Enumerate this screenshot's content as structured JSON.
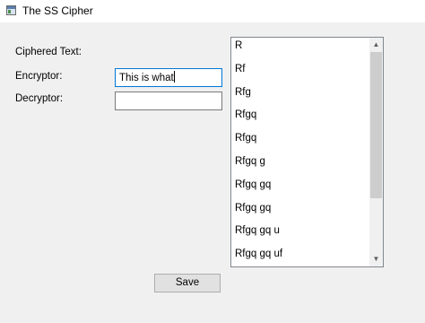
{
  "window": {
    "title": "The SS Cipher"
  },
  "form": {
    "ciphered_label": "Ciphered Text:",
    "encryptor_label": "Encryptor:",
    "decryptor_label": "Decryptor:",
    "encryptor_value": "This is what",
    "decryptor_value": ""
  },
  "listbox": {
    "items": [
      "R",
      "Rf",
      "Rfg",
      "Rfgq",
      "Rfgq",
      "Rfgq g",
      "Rfgq gq",
      "Rfgq gq",
      "Rfgq gq u",
      "Rfgq gq uf"
    ],
    "scroll": {
      "position": 0,
      "visible_fraction": 0.73
    }
  },
  "actions": {
    "save_label": "Save"
  },
  "icons": {
    "app": "app-window-icon",
    "scroll_up": "chevron-up-icon",
    "scroll_down": "chevron-down-icon"
  },
  "colors": {
    "window_bg": "#f0f0f0",
    "focus_border": "#0078d7",
    "scroll_thumb": "#cdcdcd"
  }
}
